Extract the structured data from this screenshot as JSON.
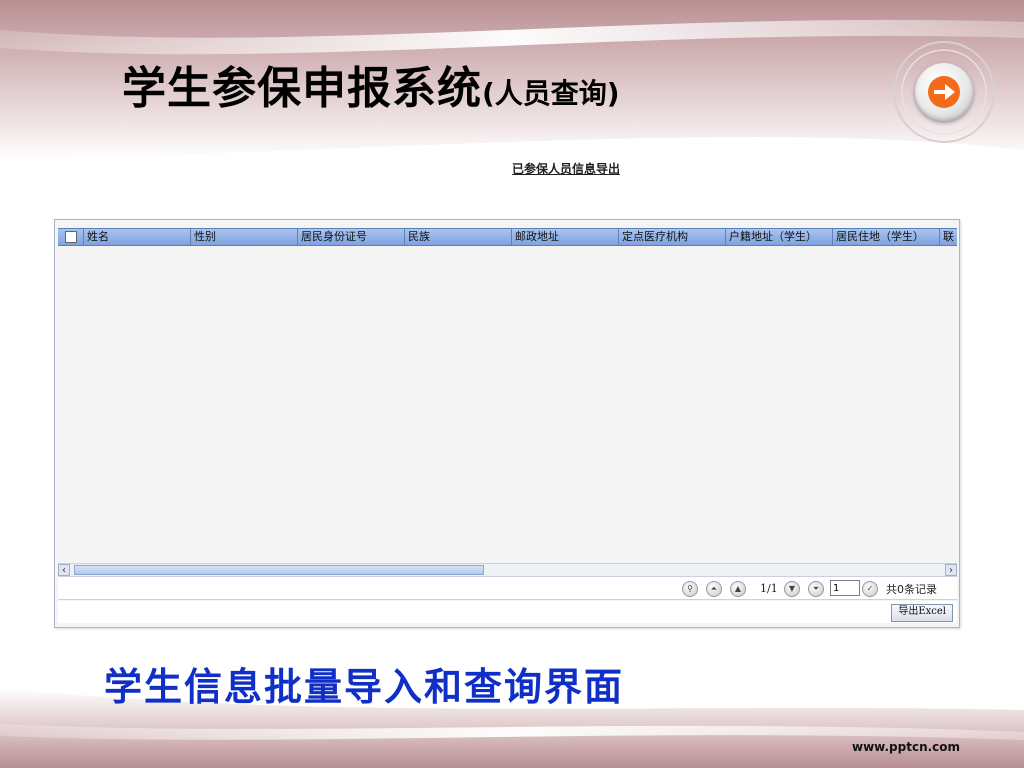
{
  "slide": {
    "title_main": "学生参保申报系统",
    "title_sub": "(人员查询)",
    "caption": "学生信息批量导入和查询界面",
    "footer_url": "www.pptcn.com"
  },
  "window": {
    "export_link": "已参保人员信息导出",
    "grid": {
      "columns": [
        "姓名",
        "性别",
        "居民身份证号",
        "民族",
        "邮政地址",
        "定点医疗机构",
        "户籍地址（学生）",
        "居民住地（学生）",
        "联"
      ],
      "rows": []
    },
    "pager": {
      "page_display": "1/1",
      "page_input": "1",
      "total_text": "共0条记录"
    },
    "export_button": "导出Excel"
  },
  "colors": {
    "header_band": "#a9c4ef",
    "caption_blue": "#0f2fc7",
    "nav_arrow": "#f26a1b",
    "slide_mauve": "#c7a1a3"
  },
  "icons": {
    "nav_button": "arrow-right-icon",
    "search": "search-icon",
    "first_page": "first-page-icon",
    "prev_page": "prev-page-icon",
    "next_page": "next-page-icon",
    "last_page": "last-page-icon",
    "go": "go-check-icon"
  }
}
